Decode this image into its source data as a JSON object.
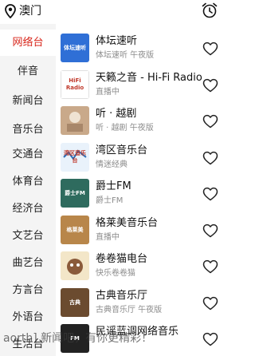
{
  "header": {
    "location": "澳门",
    "location_icon": "location-pin-icon",
    "alarm_icon": "alarm-clock-icon"
  },
  "sidebar": {
    "items": [
      {
        "label": "网络台",
        "active": true
      },
      {
        "label": "伴音"
      },
      {
        "label": "新闻台"
      },
      {
        "label": "音乐台"
      },
      {
        "label": "交通台"
      },
      {
        "label": "体育台"
      },
      {
        "label": "经济台"
      },
      {
        "label": "文艺台"
      },
      {
        "label": "曲艺台"
      },
      {
        "label": "方言台"
      },
      {
        "label": "外语台"
      },
      {
        "label": "生活台"
      }
    ]
  },
  "stations": [
    {
      "title": "体坛速听",
      "subtitle": "体坛速听 午夜版",
      "thumb_text": "体坛速听",
      "thumb_color": "#2f6fd6"
    },
    {
      "title": "天籁之音 - Hi-Fi Radio",
      "subtitle": "直播中",
      "thumb_text": "HiFi Radio",
      "thumb_color": "#ffffff"
    },
    {
      "title": "听 · 越剧",
      "subtitle": "听 · 越剧 午夜版",
      "thumb_text": "",
      "thumb_color": "#c9a98a"
    },
    {
      "title": "湾区音乐台",
      "subtitle": "情迷经典",
      "thumb_text": "湾区音乐台",
      "thumb_color": "#e9f2fb"
    },
    {
      "title": "爵士FM",
      "subtitle": "爵士FM",
      "thumb_text": "爵士FM",
      "thumb_color": "#2e6b5e"
    },
    {
      "title": "格莱美音乐台",
      "subtitle": "直播中",
      "thumb_text": "格莱美",
      "thumb_color": "#b8864a"
    },
    {
      "title": "卷卷猫电台",
      "subtitle": "快乐卷卷猫",
      "thumb_text": "",
      "thumb_color": "#f3e6c8"
    },
    {
      "title": "古典音乐厅",
      "subtitle": "古典音乐厅 午夜版",
      "thumb_text": "古典",
      "thumb_color": "#6b4b2f"
    },
    {
      "title": "民谣蓝调网络音乐",
      "subtitle": "",
      "thumb_text": "FM",
      "thumb_color": "#222222"
    }
  ],
  "heart_icon": "heart-outline-icon",
  "toast": "aorth] 新闻吧，有你更精彩！"
}
